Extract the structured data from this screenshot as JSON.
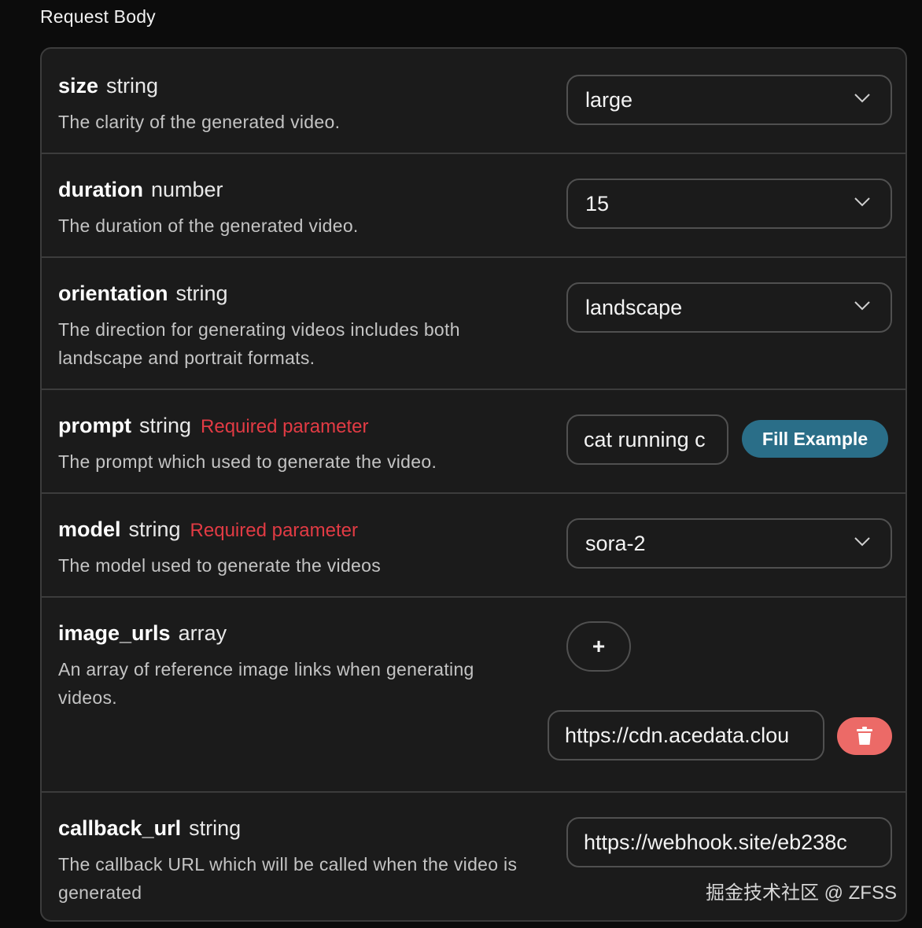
{
  "section": {
    "title": "Request Body"
  },
  "params": {
    "size": {
      "name": "size",
      "type": "string",
      "description": "The clarity of the generated video.",
      "value": "large"
    },
    "duration": {
      "name": "duration",
      "type": "number",
      "description": "The duration of the generated video.",
      "value": "15"
    },
    "orientation": {
      "name": "orientation",
      "type": "string",
      "description_line1": "The direction for generating videos includes both",
      "description_line2": "landscape and portrait formats.",
      "value": "landscape"
    },
    "prompt": {
      "name": "prompt",
      "type": "string",
      "required_label": "Required parameter",
      "description": "The prompt which used to generate the video.",
      "value": "cat running c",
      "fill_button_label": "Fill Example"
    },
    "model": {
      "name": "model",
      "type": "string",
      "required_label": "Required parameter",
      "description": "The model used to generate the videos",
      "value": "sora-2"
    },
    "image_urls": {
      "name": "image_urls",
      "type": "array",
      "description_line1": "An array of reference image links when generating",
      "description_line2": "videos.",
      "add_button_label": "+",
      "items": [
        "https://cdn.acedata.clou"
      ]
    },
    "callback_url": {
      "name": "callback_url",
      "type": "string",
      "description_line1": "The callback URL which will be called when the video is",
      "description_line2": "generated",
      "value": "https://webhook.site/eb238c"
    }
  },
  "watermark": "掘金技术社区 @ ZFSS",
  "icons": {
    "select_arrow": "chevron-down-icon",
    "delete": "trash-icon"
  },
  "colors": {
    "background": "#0c0c0c",
    "panel": "#1b1b1b",
    "border": "#3c3c3c",
    "required": "#e23b44",
    "fill_button": "#2a6e88",
    "delete_button": "#ec6a67"
  }
}
